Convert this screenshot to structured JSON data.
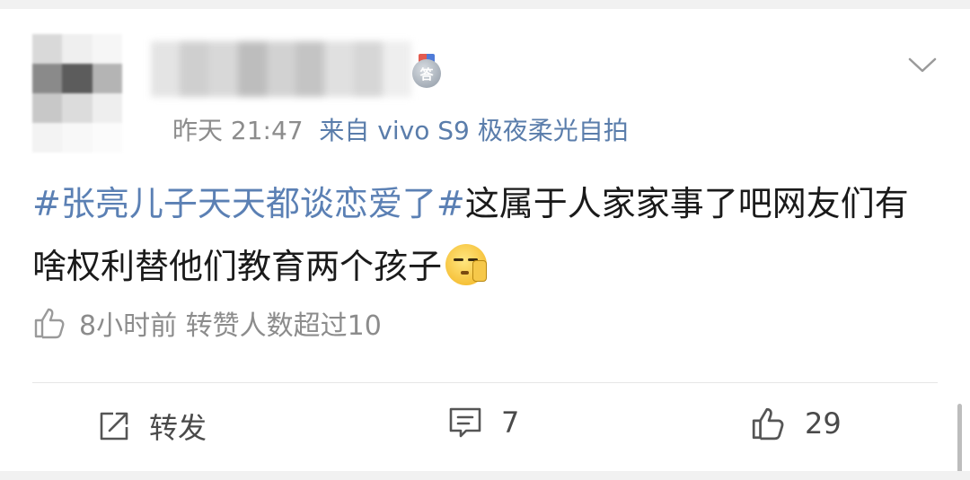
{
  "post": {
    "author": {
      "name": "",
      "badge_char": "答"
    },
    "meta": {
      "time": "昨天 21:47",
      "source": "来自 vivo S9 极夜柔光自拍"
    },
    "content": {
      "hashtag": "#张亮儿子天天都谈恋爱了#",
      "text": "这属于人家家事了吧网友们有啥权利替他们教育两个孩子",
      "emoji": "doge-whistle-emoji"
    },
    "like_notice": "8小时前 转赞人数超过10"
  },
  "actions": {
    "repost_label": "转发",
    "comment_count": "7",
    "like_count": "29"
  },
  "icons": {
    "more": "chevron-down-icon",
    "thumb": "thumbs-up-icon",
    "repost": "repost-icon",
    "comment": "comment-icon"
  },
  "colors": {
    "hashtag": "#5b80b4",
    "meta_gray": "#8c8c8c",
    "source": "#5a7dab",
    "text": "#1a1a1a"
  }
}
